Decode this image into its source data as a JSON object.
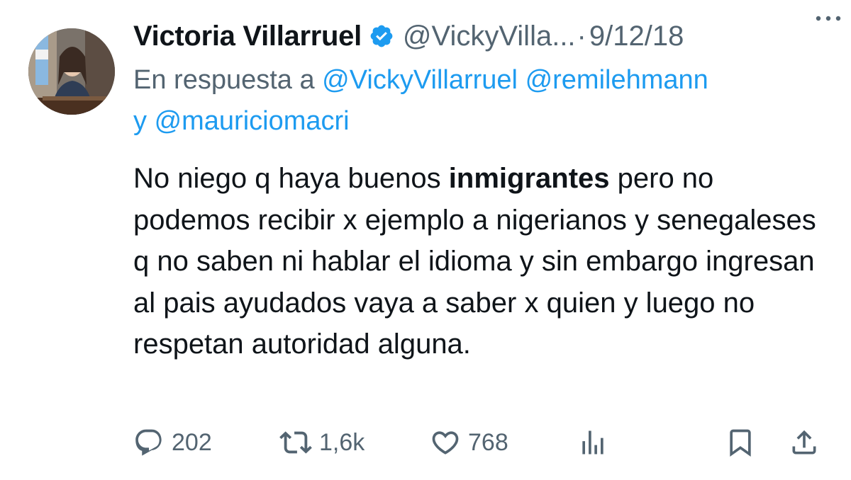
{
  "tweet": {
    "display_name": "Victoria Villarruel",
    "handle": "@VickyVilla...",
    "separator": "·",
    "date": "9/12/18",
    "reply_prefix": "En respuesta a",
    "reply_mentions": [
      "@VickyVillarruel",
      "@remilehmann"
    ],
    "reply_joiner": "y",
    "reply_last_mention": "@mauriciomacri",
    "text_before": "No niego q haya buenos ",
    "text_bold": "inmigrantes",
    "text_after": " pero no podemos recibir x ejemplo a nigerianos y senegaleses q no saben ni hablar el idioma y sin embargo ingresan al pais ayudados vaya a saber x quien y luego no respetan autoridad alguna."
  },
  "actions": {
    "replies": "202",
    "retweets": "1,6k",
    "likes": "768"
  },
  "colors": {
    "accent": "#1d9bf0",
    "secondary_text": "#536471",
    "primary_text": "#0f1419"
  },
  "icons": [
    "verified-badge-icon",
    "more-options-icon",
    "reply-icon",
    "retweet-icon",
    "like-icon",
    "views-icon",
    "bookmark-icon",
    "share-icon"
  ]
}
